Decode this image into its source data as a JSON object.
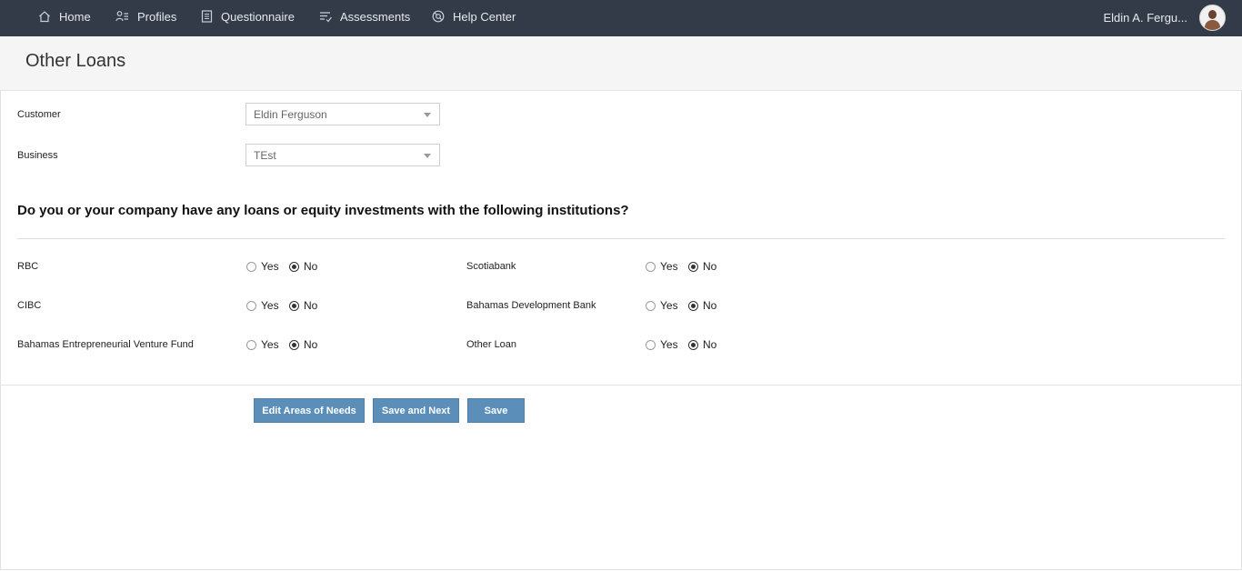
{
  "nav": {
    "items": [
      {
        "label": "Home",
        "icon": "home-icon"
      },
      {
        "label": "Profiles",
        "icon": "profiles-icon"
      },
      {
        "label": "Questionnaire",
        "icon": "questionnaire-icon"
      },
      {
        "label": "Assessments",
        "icon": "assessments-icon"
      },
      {
        "label": "Help Center",
        "icon": "help-center-icon"
      }
    ],
    "user_name": "Eldin A. Fergu..."
  },
  "page": {
    "title": "Other Loans"
  },
  "form": {
    "customer": {
      "label": "Customer",
      "value": "Eldin Ferguson"
    },
    "business": {
      "label": "Business",
      "value": "TEst"
    },
    "question": "Do you or your company have any loans or equity investments with the following institutions?",
    "yes_label": "Yes",
    "no_label": "No",
    "institutions": [
      {
        "name": "RBC",
        "selected": "No"
      },
      {
        "name": "Scotiabank",
        "selected": "No"
      },
      {
        "name": "CIBC",
        "selected": "No"
      },
      {
        "name": "Bahamas Development Bank",
        "selected": "No"
      },
      {
        "name": "Bahamas Entrepreneurial Venture Fund",
        "selected": "No"
      },
      {
        "name": "Other Loan",
        "selected": "No"
      }
    ]
  },
  "buttons": {
    "edit": "Edit Areas of Needs",
    "save_next": "Save and Next",
    "save": "Save"
  },
  "colors": {
    "topbar": "#333b48",
    "button": "#5b8fb9"
  }
}
